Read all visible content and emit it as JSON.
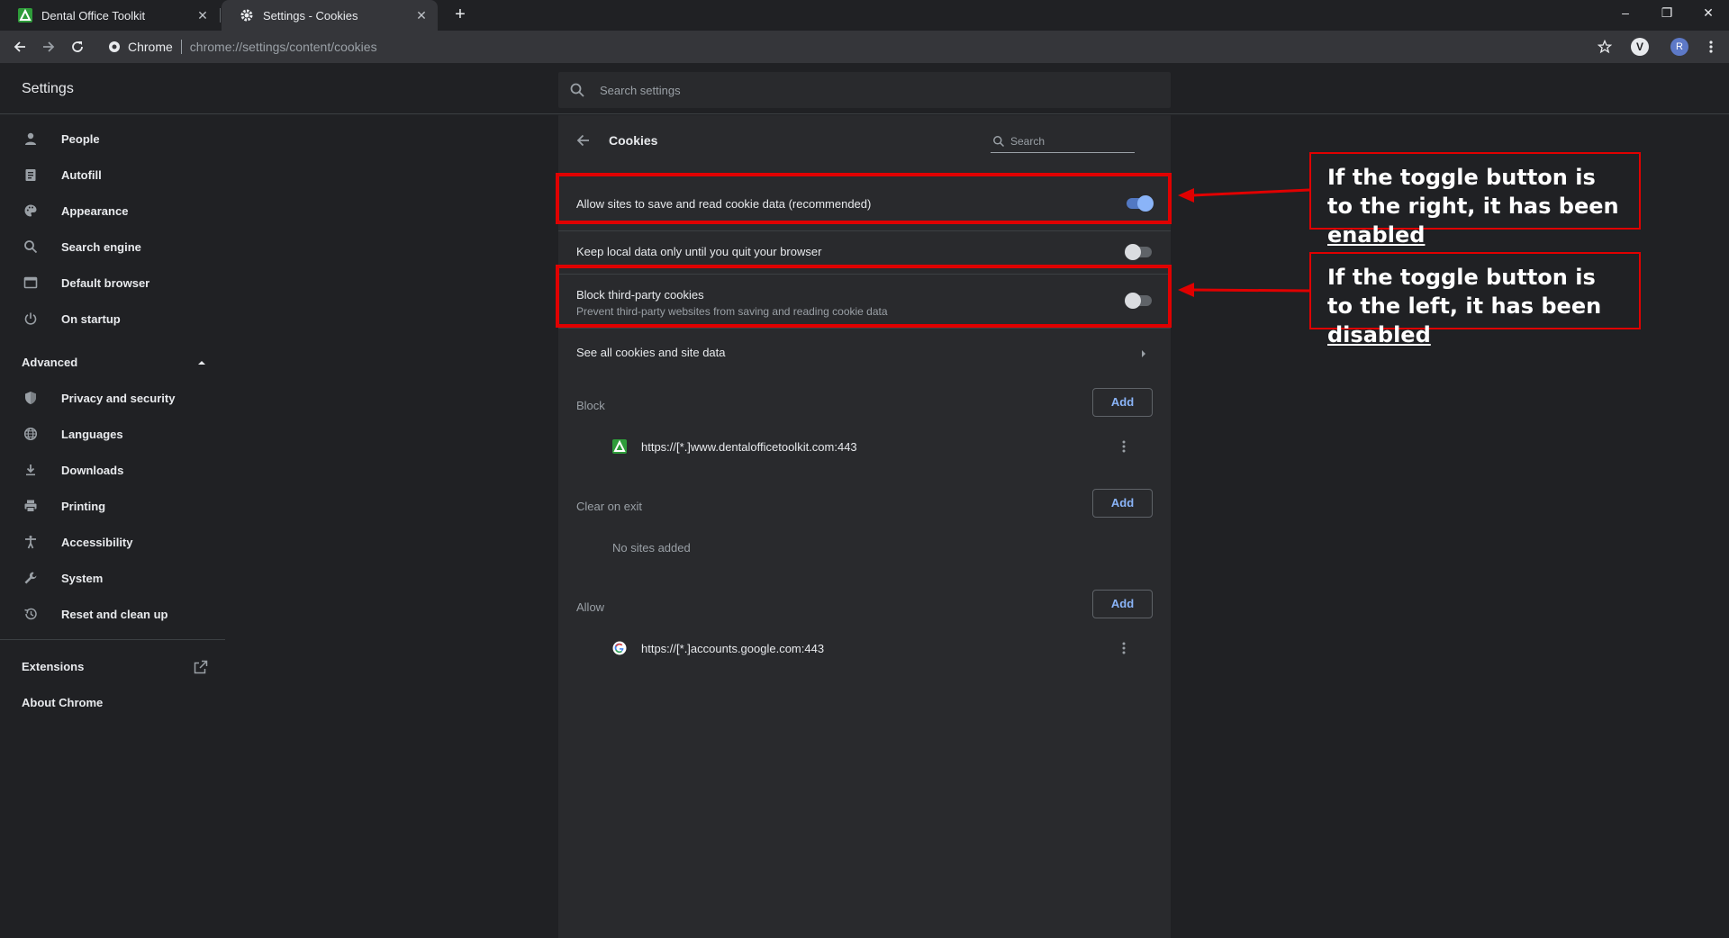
{
  "browser": {
    "tabs": [
      {
        "label": "Dental Office Toolkit",
        "favicon": "dental-office-toolkit-favicon",
        "active": false
      },
      {
        "label": "Settings - Cookies",
        "favicon": "gear-icon",
        "active": true
      }
    ],
    "omnibox": {
      "chip": "Chrome",
      "url": "chrome://settings/content/cookies"
    },
    "profile_initial": "R",
    "extension_initial": "V"
  },
  "settings": {
    "title": "Settings",
    "search_placeholder": "Search settings"
  },
  "sidebar": {
    "items": [
      {
        "label": "People",
        "icon": "person-icon"
      },
      {
        "label": "Autofill",
        "icon": "clipboard-icon"
      },
      {
        "label": "Appearance",
        "icon": "palette-icon"
      },
      {
        "label": "Search engine",
        "icon": "search-icon"
      },
      {
        "label": "Default browser",
        "icon": "browser-window-icon"
      },
      {
        "label": "On startup",
        "icon": "power-icon"
      }
    ],
    "advanced_label": "Advanced",
    "advanced_items": [
      {
        "label": "Privacy and security",
        "icon": "shield-icon"
      },
      {
        "label": "Languages",
        "icon": "globe-icon"
      },
      {
        "label": "Downloads",
        "icon": "download-icon"
      },
      {
        "label": "Printing",
        "icon": "printer-icon"
      },
      {
        "label": "Accessibility",
        "icon": "accessibility-icon"
      },
      {
        "label": "System",
        "icon": "wrench-icon"
      },
      {
        "label": "Reset and clean up",
        "icon": "history-icon"
      }
    ],
    "extensions_label": "Extensions",
    "about_label": "About Chrome"
  },
  "cookies": {
    "title": "Cookies",
    "search_placeholder": "Search",
    "toggles": [
      {
        "label": "Allow sites to save and read cookie data (recommended)",
        "sublabel": "",
        "enabled": true
      },
      {
        "label": "Keep local data only until you quit your browser",
        "sublabel": "",
        "enabled": false
      },
      {
        "label": "Block third-party cookies",
        "sublabel": "Prevent third-party websites from saving and reading cookie data",
        "enabled": false
      }
    ],
    "see_all_label": "See all cookies and site data",
    "sections": {
      "block": {
        "label": "Block",
        "add_label": "Add",
        "sites": [
          {
            "url": "https://[*.]www.dentalofficetoolkit.com:443",
            "favicon": "dental-office-toolkit-favicon"
          }
        ]
      },
      "clear_on_exit": {
        "label": "Clear on exit",
        "add_label": "Add",
        "empty_text": "No sites added"
      },
      "allow": {
        "label": "Allow",
        "add_label": "Add",
        "sites": [
          {
            "url": "https://[*.]accounts.google.com:443",
            "favicon": "google-favicon"
          }
        ]
      }
    }
  },
  "annotations": {
    "enabled_note": {
      "prefix": "If the toggle button is to the right, it has been ",
      "emphasis": "enabled"
    },
    "disabled_note": {
      "prefix": "If the toggle button is to the left, it has been ",
      "emphasis": "disabled"
    },
    "highlight_color": "#e00000"
  },
  "colors": {
    "accent": "#8ab4f8",
    "toggle_track_on": "#5278c2",
    "card_background": "#292a2d",
    "page_background": "#202124"
  }
}
